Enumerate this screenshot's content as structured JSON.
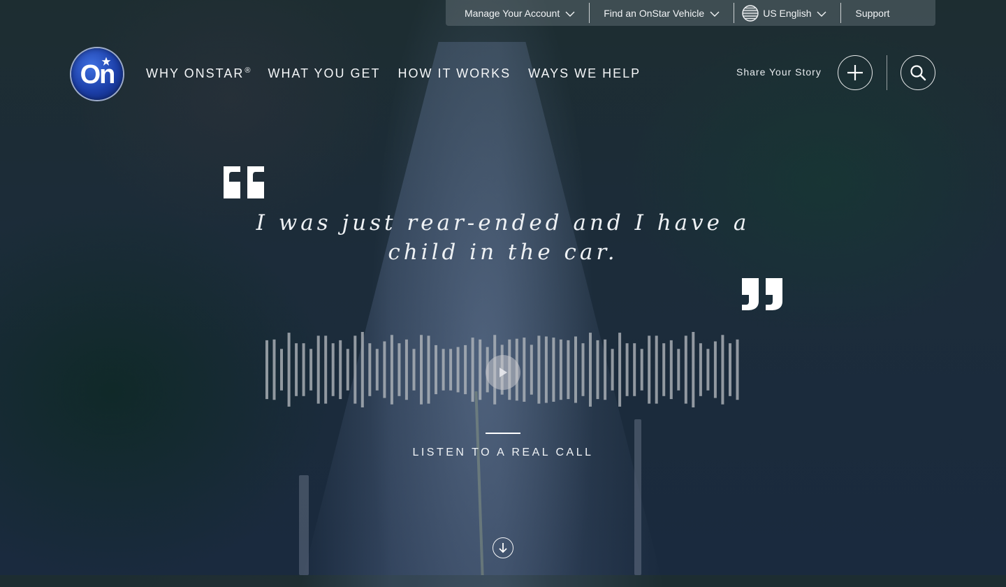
{
  "utility_bar": {
    "manage_account": "Manage Your Account",
    "find_vehicle": "Find an OnStar Vehicle",
    "language": "US English",
    "support": "Support",
    "icons": [
      "chevron-down-icon",
      "globe-icon"
    ]
  },
  "logo": {
    "text": "On",
    "icon": "star-icon"
  },
  "nav": {
    "items": [
      {
        "label": "WHY ONSTAR",
        "mark": "®"
      },
      {
        "label": "WHAT YOU GET"
      },
      {
        "label": "HOW IT WORKS"
      },
      {
        "label": "WAYS WE HELP"
      }
    ]
  },
  "header_actions": {
    "share_label": "Share Your Story",
    "icons": [
      "plus-icon",
      "search-icon"
    ]
  },
  "hero": {
    "quote": "I was just rear-ended and I have a child in the car.",
    "cta_label": "LISTEN TO A REAL CALL",
    "icons": [
      "open-quote-icon",
      "close-quote-icon",
      "play-icon",
      "arrow-down-icon"
    ]
  },
  "colors": {
    "text": "#ffffff",
    "logo_blue": "#1c3fa8",
    "waveform": "#b4b8be"
  }
}
